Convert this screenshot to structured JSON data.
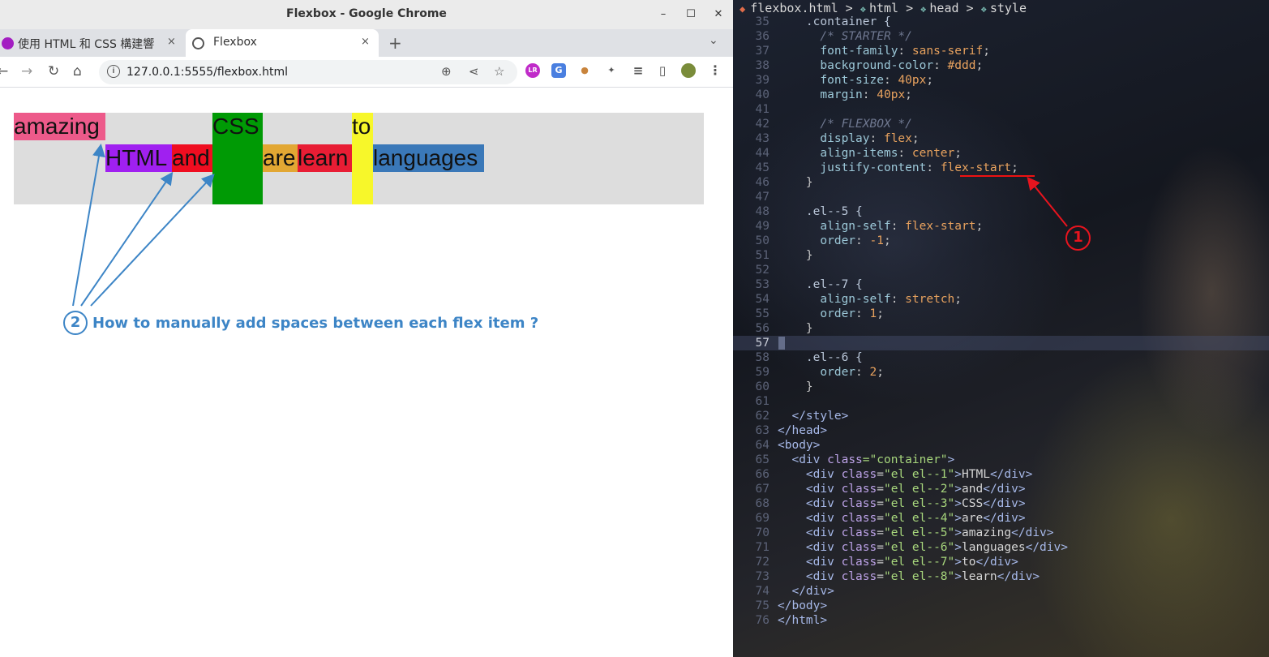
{
  "window": {
    "title": "Flexbox - Google Chrome",
    "minimize": "–",
    "maximize": "☐",
    "close": "✕"
  },
  "tabs": [
    {
      "label": "使用 HTML 和 CSS 構建響",
      "close": "×"
    },
    {
      "label": "Flexbox",
      "close": "×"
    }
  ],
  "newtab": "+",
  "tabmenu": "⌄",
  "toolbar": {
    "back": "←",
    "forward": "→",
    "reload": "↻",
    "home": "⌂",
    "url": "127.0.0.1:5555/flexbox.html",
    "info": "i",
    "zoom": "⊕",
    "share": "⋖",
    "star": "☆",
    "ext_tr": "LR",
    "ext_translate": "G",
    "ext_cookie": "●",
    "ext_puzzle": "✦",
    "ext_media": "≡",
    "ext_sidepanel": "▯",
    "menu": "⋮"
  },
  "flex_items": {
    "el1": "HTML",
    "el2": "and",
    "el3": "CSS",
    "el4": "are",
    "el5": "amazing",
    "el6": "languages",
    "el7": "to",
    "el8": "learn"
  },
  "annotation": {
    "number": "2",
    "question": "How to manually add spaces between each flex item ?"
  },
  "editor": {
    "breadcrumb": {
      "file": "flexbox.html",
      "sep": ">",
      "html": "html",
      "head": "head",
      "style": "style"
    },
    "badge": "1",
    "line_numbers": [
      "35",
      "36",
      "37",
      "38",
      "39",
      "40",
      "41",
      "42",
      "43",
      "44",
      "45",
      "46",
      "47",
      "48",
      "49",
      "50",
      "51",
      "52",
      "53",
      "54",
      "55",
      "56",
      "57",
      "58",
      "59",
      "60",
      "61",
      "62",
      "63",
      "64",
      "65",
      "66",
      "67",
      "68",
      "69",
      "70",
      "71",
      "72",
      "73",
      "74",
      "75",
      "76"
    ],
    "code": {
      "l35": ".container {",
      "l36": "/* STARTER */",
      "l37p": "font-family",
      "l37v": "sans-serif",
      "l38p": "background-color",
      "l38v": "#ddd",
      "l39p": "font-size",
      "l39v": "40px",
      "l40p": "margin",
      "l40v": "40px",
      "l42": "/* FLEXBOX */",
      "l43p": "display",
      "l43v": "flex",
      "l44p": "align-items",
      "l44v": "center",
      "l45p": "justify-content",
      "l45v": "flex-start",
      "l48": ".el--5 {",
      "l49p": "align-self",
      "l49v": "flex-start",
      "l50p": "order",
      "l50v": "-1",
      "l53": ".el--7 {",
      "l54p": "align-self",
      "l54v": "stretch",
      "l55p": "order",
      "l55v": "1",
      "l58": ".el--6 {",
      "l59p": "order",
      "l59v": "2",
      "close": "}",
      "l62": "</style>",
      "l63": "</head>",
      "l64": "<body>",
      "l65a": "<div ",
      "l65b": "class",
      "l65c": "=\"container\"",
      "l65d": ">",
      "items": [
        {
          "cls": "\"el el--1\"",
          "txt": "HTML"
        },
        {
          "cls": "\"el el--2\"",
          "txt": "and"
        },
        {
          "cls": "\"el el--3\"",
          "txt": "CSS"
        },
        {
          "cls": "\"el el--4\"",
          "txt": "are"
        },
        {
          "cls": "\"el el--5\"",
          "txt": "amazing"
        },
        {
          "cls": "\"el el--6\"",
          "txt": "languages"
        },
        {
          "cls": "\"el el--7\"",
          "txt": "to"
        },
        {
          "cls": "\"el el--8\"",
          "txt": "learn"
        }
      ],
      "div_open": "<div ",
      "class_attr": "class",
      "eq": "=",
      "gt": ">",
      "div_close": "</div>",
      "l74": "</div>",
      "l75": "</body>",
      "l76": "</html>"
    }
  },
  "colors": {
    "el1": "#a020f0",
    "el2": "#ef0d20",
    "el3": "#009a05",
    "el4": "#e2a733",
    "el5": "#ed5a8a",
    "el6": "#3a78b8",
    "el7": "#f7f72a",
    "el8": "#e81d34",
    "container": "#dddddd",
    "annotation_blue": "#3d85c6",
    "annotation_red": "#e8141e"
  }
}
